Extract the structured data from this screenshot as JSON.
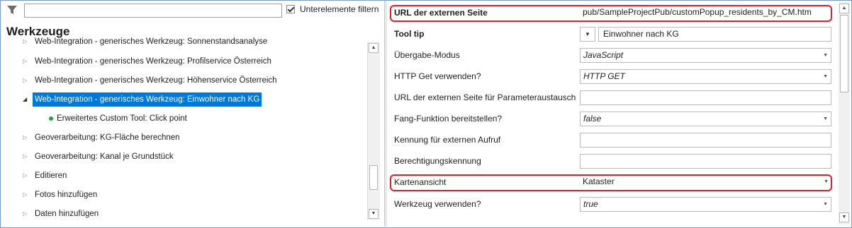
{
  "left": {
    "filter_placeholder": "",
    "subitems_filter_label": "Unterelemente filtern",
    "subitems_filter_checked": true,
    "title": "Werkzeuge",
    "tree_items": [
      {
        "label": "Web-Integration - generisches Werkzeug: Sonnenstandsanalyse",
        "expanded": false,
        "selected": false,
        "child": false
      },
      {
        "label": "Web-Integration - generisches Werkzeug: Profilservice Österreich",
        "expanded": false,
        "selected": false,
        "child": false
      },
      {
        "label": "Web-Integration - generisches Werkzeug: Höhenservice Österreich",
        "expanded": false,
        "selected": false,
        "child": false
      },
      {
        "label": "Web-Integration - generisches Werkzeug: Einwohner nach KG",
        "expanded": true,
        "selected": true,
        "child": false
      },
      {
        "label": "Erweitertes Custom Tool: Click point",
        "expanded": false,
        "selected": false,
        "child": true
      },
      {
        "label": "Geoverarbeitung: KG-Fläche berechnen",
        "expanded": false,
        "selected": false,
        "child": false
      },
      {
        "label": "Geoverarbeitung: Kanal je Grundstück",
        "expanded": false,
        "selected": false,
        "child": false
      },
      {
        "label": "Editieren",
        "expanded": false,
        "selected": false,
        "child": false
      },
      {
        "label": "Fotos hinzufügen",
        "expanded": false,
        "selected": false,
        "child": false
      },
      {
        "label": "Daten hinzufügen",
        "expanded": false,
        "selected": false,
        "child": false
      }
    ]
  },
  "properties": {
    "url": {
      "label": "URL der externen Seite",
      "value": "pub/SampleProjectPub/customPopup_residents_by_CM.htm"
    },
    "tooltip": {
      "label": "Tool tip",
      "value": "Einwohner nach KG"
    },
    "mode": {
      "label": "Übergabe-Modus",
      "value": "JavaScript"
    },
    "http_get": {
      "label": "HTTP Get verwenden?",
      "value": "HTTP GET"
    },
    "url_param": {
      "label": "URL der externen Seite für Parameteraustausch",
      "value": ""
    },
    "snap": {
      "label": "Fang-Funktion bereitstellen?",
      "value": "false"
    },
    "ext_id": {
      "label": "Kennung für externen Aufruf",
      "value": ""
    },
    "perm": {
      "label": "Berechtigungskennung",
      "value": ""
    },
    "mapview": {
      "label": "Kartenansicht",
      "value": "Kataster"
    },
    "use_tool": {
      "label": "Werkzeug verwenden?",
      "value": "true"
    }
  },
  "colors": {
    "highlight": "#e0202a",
    "selection": "#0078d7",
    "child_dot": "#22a33a"
  }
}
